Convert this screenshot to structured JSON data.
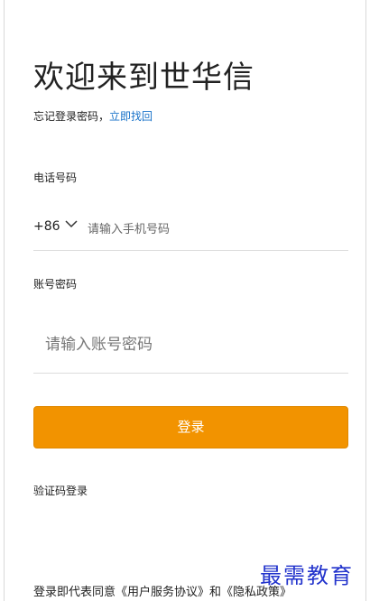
{
  "header": {
    "title": "欢迎来到世华信",
    "forgot_text": "忘记登录密码，",
    "forgot_link": "立即找回"
  },
  "phone": {
    "label": "电话号码",
    "country_code": "+86",
    "chevron_icon": "chevron-down-icon",
    "placeholder": "请输入手机号码",
    "value": ""
  },
  "password": {
    "label": "账号密码",
    "placeholder": "请输入账号密码",
    "value": ""
  },
  "actions": {
    "login_label": "登录",
    "sms_login": "验证码登录"
  },
  "footer": {
    "agreement_prefix": "登录即代表同意",
    "user_agreement": "《用户服务协议》",
    "and": "和",
    "privacy_policy": "《隐私政策》"
  },
  "watermark": {
    "text": "最需教育"
  },
  "colors": {
    "accent": "#f29300",
    "link": "#1a73c9",
    "watermark": "#2233cc"
  }
}
